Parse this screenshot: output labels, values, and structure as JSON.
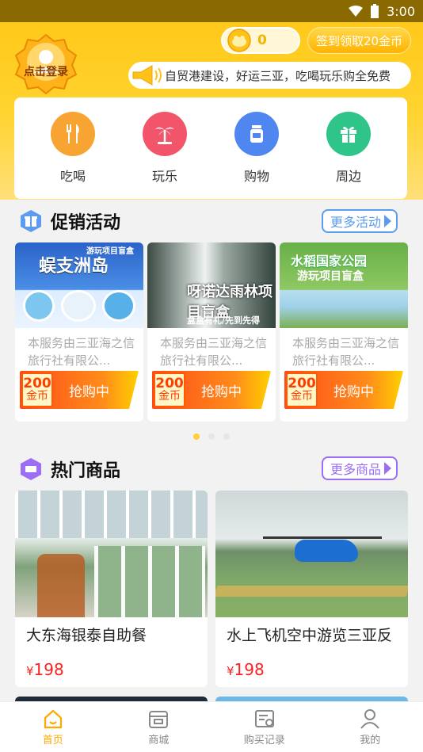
{
  "status_bar": {
    "time": "3:00"
  },
  "header": {
    "login_label": "点击登录",
    "coin_count": "0",
    "signin_button": "签到领取20金币",
    "notice_text": "自贸港建设，好运三亚，吃喝玩乐购全免费"
  },
  "categories": [
    {
      "label": "吃喝",
      "color": "#f7a433"
    },
    {
      "label": "玩乐",
      "color": "#f2546a"
    },
    {
      "label": "购物",
      "color": "#4f86f0"
    },
    {
      "label": "周边",
      "color": "#2fc58a"
    }
  ],
  "promo_section": {
    "title": "促销活动",
    "more": "更多活动",
    "accent": "#5b9bf0",
    "items": [
      {
        "image_title": "蜈支洲岛",
        "image_sub": "游玩项目盲盒",
        "desc": "本服务由三亚海之信旅行社有限公...",
        "coins": "200",
        "coin_unit": "金币",
        "action": "抢购中"
      },
      {
        "image_title": "呀诺达雨林项目盲盒",
        "image_sub": "盒盒有礼/先到先得",
        "desc": "本服务由三亚海之信旅行社有限公...",
        "coins": "200",
        "coin_unit": "金币",
        "action": "抢购中"
      },
      {
        "image_title": "水稻国家公园",
        "image_sub": "游玩项目盲盒",
        "desc": "本服务由三亚海之信旅行社有限公...",
        "coins": "200",
        "coin_unit": "金币",
        "action": "抢购中"
      }
    ]
  },
  "hot_section": {
    "title": "热门商品",
    "more": "更多商品",
    "accent": "#9b6ef3",
    "items": [
      {
        "name": "大东海银泰自助餐",
        "currency": "¥",
        "price": "198"
      },
      {
        "name": "水上飞机空中游览三亚反",
        "currency": "¥",
        "price": "198"
      }
    ]
  },
  "tabbar": {
    "tabs": [
      {
        "label": "首页",
        "icon": "home-icon"
      },
      {
        "label": "商城",
        "icon": "store-icon"
      },
      {
        "label": "购买记录",
        "icon": "orders-icon"
      },
      {
        "label": "我的",
        "icon": "user-icon"
      }
    ],
    "active_color": "#ffa800"
  }
}
